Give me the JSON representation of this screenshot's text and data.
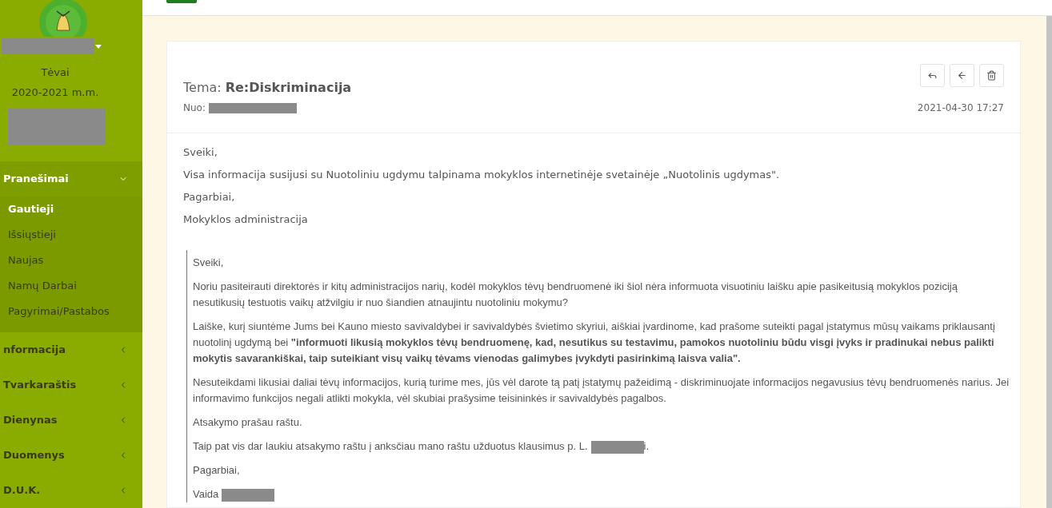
{
  "sidebar": {
    "role": "Tėvai",
    "school_year": "2020-2021 m.m.",
    "menu": [
      {
        "label": "Pranešimai",
        "expanded": true,
        "children": [
          {
            "label": "Gautieji",
            "selected": true
          },
          {
            "label": "Išsiųstieji",
            "selected": false
          },
          {
            "label": "Naujas",
            "selected": false
          },
          {
            "label": "Namų Darbai",
            "selected": false
          },
          {
            "label": "Pagyrimai/Pastabos",
            "selected": false
          }
        ]
      },
      {
        "label": "nformacija",
        "expanded": false
      },
      {
        "label": "Tvarkaraštis",
        "expanded": false
      },
      {
        "label": "Dienynas",
        "expanded": false
      },
      {
        "label": "Duomenys",
        "expanded": false
      },
      {
        "label": "D.U.K.",
        "expanded": false
      }
    ]
  },
  "message": {
    "subject_label": "Tema:",
    "subject": "Re:Diskriminacija",
    "from_label": "Nuo:",
    "date": "2021-04-30 17:27",
    "actions": [
      {
        "kind": "reply"
      },
      {
        "kind": "back"
      },
      {
        "kind": "delete"
      }
    ],
    "body": [
      {
        "kind": "text",
        "text": "Sveiki,"
      },
      {
        "kind": "text",
        "text": "Visa informacija susijusi su Nuotoliniu ugdymu talpinama mokyklos internetinėje svetainėje „Nuotolinis ugdymas\"."
      },
      {
        "kind": "text",
        "text": "Pagarbiai,"
      },
      {
        "kind": "text",
        "text": "Mokyklos administracija"
      }
    ],
    "quote": [
      {
        "kind": "text",
        "text": "Sveiki,"
      },
      {
        "kind": "text",
        "text": "Noriu pasiteirauti direktorės ir kitų administracijos narių, kodėl mokyklos tėvų bendruomenė iki šiol nėra informuota visuotiniu laišku apie pasikeitusią mokyklos poziciją nesutikusių testuotis vaikų atžvilgiu ir nuo šiandien atnaujintu nuotoliniu mokymu?"
      },
      {
        "kind": "text",
        "text": "Laiške, kurį siuntėme Jums bei Kauno miesto savivaldybei ir savivaldybės švietimo skyriui, aiškiai įvardinome, kad prašome suteikti pagal įstatymus mūsų vaikams priklausantį nuotolinį ugdymą bei **\"informuoti likusią mokyklos tėvų bendruomenę, kad, nesutikus su testavimu, pamokos nuotoliniu būdu visgi įvyks ir pradinukai nebus palikti mokytis savarankiškai, taip suteikiant visų vaikų tėvams vienodas galimybes įvykdyti pasirinkimą laisva valia\".**"
      },
      {
        "kind": "text",
        "text": "Nesuteikdami likusiai daliai tėvų informacijos, kurią turime mes, jūs vėl darote tą patį įstatymų pažeidimą - diskriminuojate informacijos negavusius tėvų bendruomenės narius. Jei informavimo funkcijos negali atlikti mokykla, vėl skubiai prašysime teisininkės ir savivaldybės pagalbos."
      },
      {
        "kind": "text",
        "text": "Atsakymo prašau raštu."
      },
      {
        "kind": "redacted",
        "before": "Taip pat vis dar laukiu atsakymo raštu į anksčiau mano raštu užduotus klausimus p. L.",
        "after": "i."
      },
      {
        "kind": "text",
        "text": "Pagarbiai,"
      },
      {
        "kind": "redacted",
        "before": "Vaida"
      }
    ]
  }
}
